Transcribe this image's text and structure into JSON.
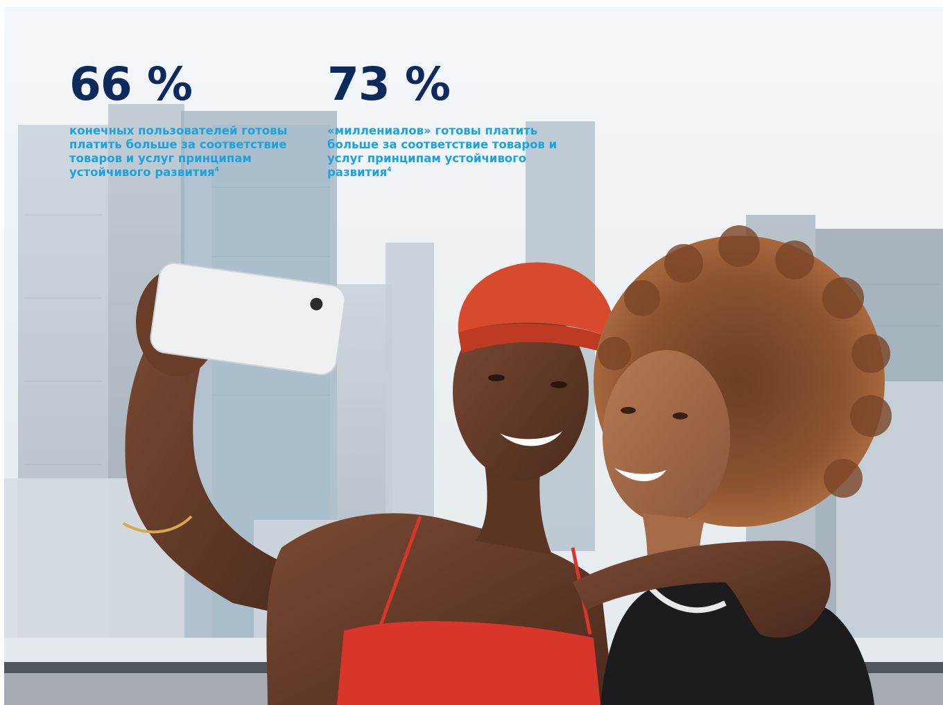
{
  "stats": [
    {
      "value": "66 %",
      "description": "конечных пользователей готовы платить больше за соответствие товаров и услуг принципам устойчивого развития",
      "footnote": "4"
    },
    {
      "value": "73 %",
      "description": "«миллениалов» готовы платить больше за соответствие товаров и услуг принципам устойчивого развития",
      "footnote": "4"
    }
  ],
  "colors": {
    "value": "#0d2a5c",
    "description": "#1aa3df"
  },
  "photo": {
    "subject": "selfie-photo"
  }
}
